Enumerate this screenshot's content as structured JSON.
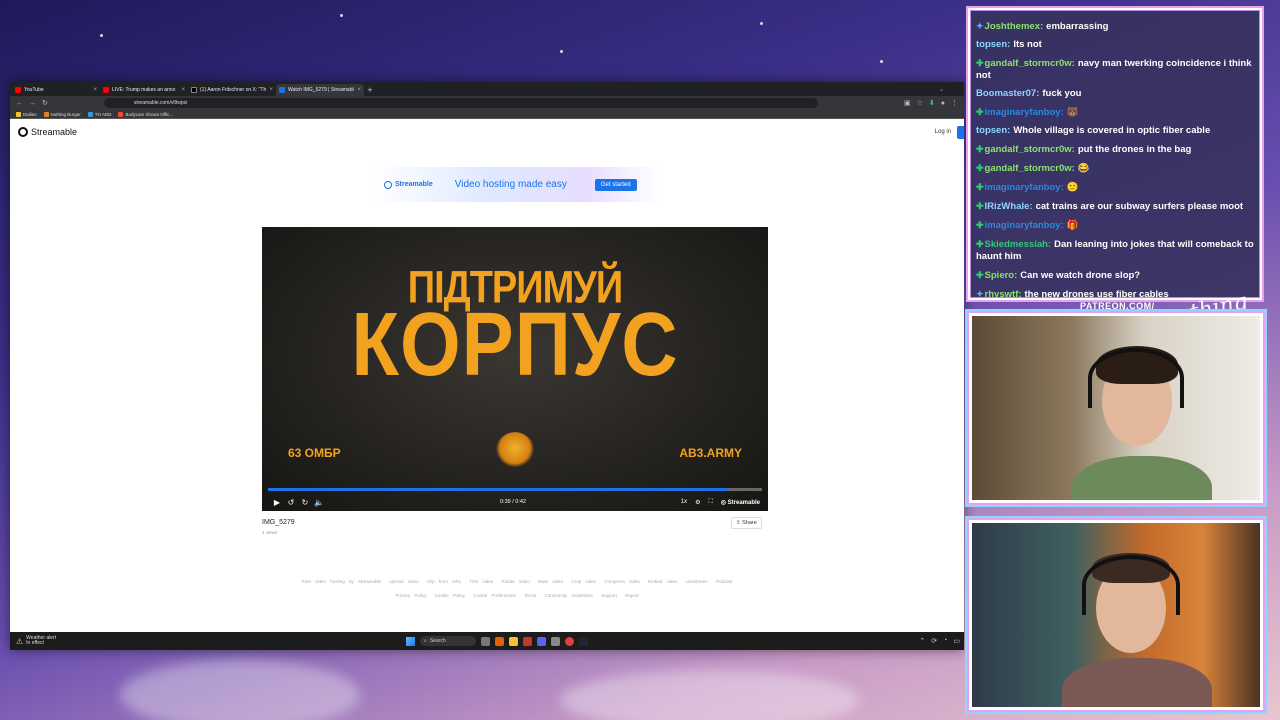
{
  "browser": {
    "tabs": [
      {
        "title": "YouTube",
        "color": "#ff0000",
        "active": false
      },
      {
        "title": "LIVE: Trump makes an anno",
        "color": "#ff0000",
        "active": false
      },
      {
        "title": "(1) Aaron Fritschner on X: \"The",
        "color": "#000000",
        "active": false
      },
      {
        "title": "Watch IMG_5279 | Streamable",
        "color": "#1a73e8",
        "active": true
      }
    ],
    "new_tab": "+",
    "url": "streamable.com/vl9wpsi",
    "bookmarks": [
      {
        "label": "Dailies",
        "color": "#f4c430"
      },
      {
        "label": "Nothing Burger",
        "color": "#e67e22"
      },
      {
        "label": "TO ADD",
        "color": "#3498db"
      },
      {
        "label": "Bodycam Shows Offic...",
        "color": "#e74c3c"
      }
    ]
  },
  "site": {
    "brand": "Streamable",
    "login": "Log in",
    "banner": {
      "brand": "Streamable",
      "title": "Video hosting made easy",
      "cta": "Get started"
    },
    "video": {
      "line1": "ПІДТРИМУЙ",
      "line2": "КОРПУС",
      "left_text": "63 ОМБР",
      "right_text": "АВ3.ARMY",
      "time": "0:39 / 0:42",
      "progress": 0.93,
      "speed": "1x",
      "brand": "Streamable"
    },
    "video_title": "IMG_5279",
    "video_views": "4 views",
    "share": "Share",
    "footer_row1": [
      "Free video hosting by Streamable",
      "Upload video",
      "Clip from URL",
      "Trim video",
      "Rotate video",
      "Mute video",
      "Crop video",
      "Compress video",
      "Embed video",
      "Livestream",
      "Podcast"
    ],
    "footer_row2": [
      "Privacy Policy",
      "Cookie Policy",
      "Cookie Preferences",
      "Terms",
      "Community Guidelines",
      "Support",
      "Report"
    ]
  },
  "taskbar": {
    "weather_title": "Weather alert",
    "weather_sub": "In effect",
    "search": "Search"
  },
  "chat": {
    "messages": [
      {
        "user": "Joshthemex:",
        "text": "embarrassing",
        "color": "#8be36b",
        "badge": "diamond"
      },
      {
        "user": "topsen:",
        "text": "Its not",
        "color": "#8fd6ff",
        "badge": ""
      },
      {
        "user": "gandalf_stormcr0w:",
        "text": "navy man twerking coincidence i think not",
        "color": "#8be36b",
        "badge": "plus"
      },
      {
        "user": "Boomaster07:",
        "text": "fuck you",
        "color": "#8fd6ff",
        "badge": ""
      },
      {
        "user": "imaginaryfanboy:",
        "text": "🐻",
        "color": "#2e86de",
        "badge": "plus"
      },
      {
        "user": "topsen:",
        "text": "Whole village is covered in optic fiber cable",
        "color": "#8fd6ff",
        "badge": ""
      },
      {
        "user": "gandalf_stormcr0w:",
        "text": "put the drones in the bag",
        "color": "#8be36b",
        "badge": "plus"
      },
      {
        "user": "gandalf_stormcr0w:",
        "text": "😂",
        "color": "#8be36b",
        "badge": "plus"
      },
      {
        "user": "imaginaryfanboy:",
        "text": "🙂",
        "color": "#2e86de",
        "badge": "plus"
      },
      {
        "user": "IRizWhale:",
        "text": "cat trains are our subway surfers please moot",
        "color": "#8fd6ff",
        "badge": "plus"
      },
      {
        "user": "imaginaryfanboy:",
        "text": "🎁",
        "color": "#2e86de",
        "badge": "plus"
      },
      {
        "user": "Skiedmessiah:",
        "text": "Dan leaning into jokes that will comeback to haunt him",
        "color": "#2ecc71",
        "badge": "plus"
      },
      {
        "user": "Spiero:",
        "text": "Can we watch drone slop?",
        "color": "#8be36b",
        "badge": "plus"
      },
      {
        "user": "rhyswtf:",
        "text": "the new drones use fiber cables",
        "color": "#8be36b",
        "badge": "diamond"
      }
    ]
  },
  "overlay": {
    "patreon": "PATREON.COM/",
    "signature": "Anything Goes"
  }
}
